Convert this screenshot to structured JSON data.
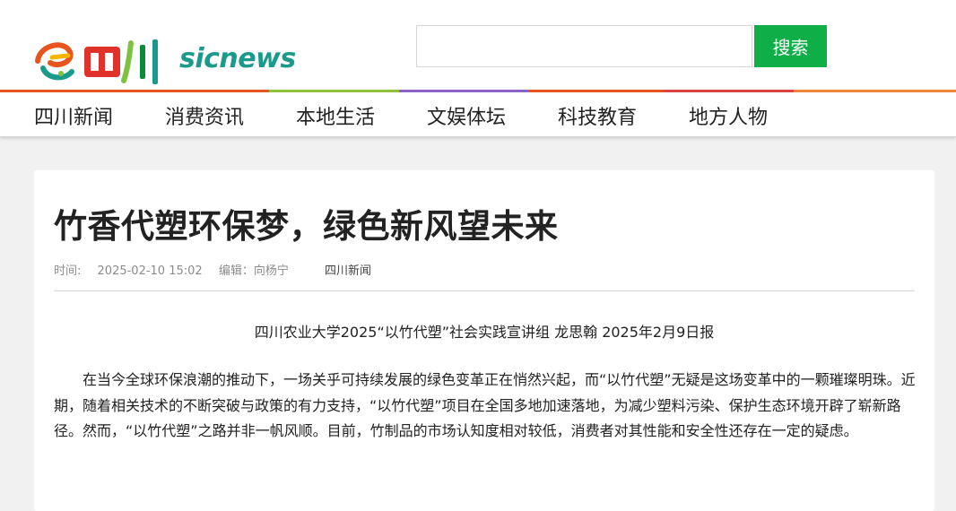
{
  "header": {
    "logo_cn": "四川",
    "logo_en": "sicnews",
    "search_placeholder": "",
    "search_label": "搜索",
    "brand_colors": [
      "#e8541d",
      "#f7b500",
      "#7fc241",
      "#8d63c9",
      "#d94444",
      "#1a9a8a"
    ]
  },
  "nav": {
    "items": [
      "四川新闻",
      "消费资讯",
      "本地生活",
      "文娱体坛",
      "科技教育",
      "地方人物"
    ]
  },
  "article": {
    "title": "竹香代塑环保梦，绿色新风望未来",
    "time_label": "时间:",
    "time_value": "2025-02-10 15:02",
    "editor": "编辑：向杨宁",
    "channel": "四川新闻",
    "byline": "四川农业大学2025“以竹代塑”社会实践宣讲组  龙思翰  2025年2月9日报",
    "paragraph": "在当今全球环保浪潮的推动下，一场关乎可持续发展的绿色变革正在悄然兴起，而“以竹代塑”无疑是这场变革中的一颗璀璨明珠。近期，随着相关技术的不断突破与政策的有力支持，“以竹代塑”项目在全国多地加速落地，为减少塑料污染、保护生态环境开辟了崭新路径。然而，“以竹代塑”之路并非一帆风顺。目前，竹制品的市场认知度相对较低，消费者对其性能和安全性还存在一定的疑虑。"
  }
}
